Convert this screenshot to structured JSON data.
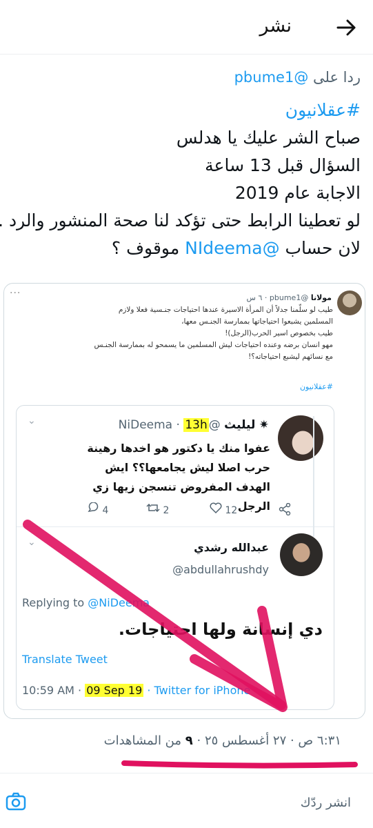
{
  "header": {
    "title": "نشر",
    "back_icon": "arrow-right-icon"
  },
  "reply_context": {
    "prefix": "ردا على",
    "handle": "@pbume1"
  },
  "tweet": {
    "hashtag": "#عقلانيون",
    "lines": [
      "صباح الشر عليك يا هدلس",
      "السؤال قبل 13 ساعة",
      "الاجابة عام 2019",
      "لو تعطينا الرابط حتى تؤكد لنا صحة المنشور والرد ."
    ],
    "last_line_prefix": "لان حساب",
    "last_line_mention": "@NIdeema",
    "last_line_suffix": "موقوف ؟"
  },
  "screenshot": {
    "author_name": "مولانا",
    "author_handle": "@pbume1",
    "author_time": "· ٦ س",
    "more_icon": "···",
    "body": [
      "طيب لو سلّمنا جدلاً أن المرأة الاسيرة عندها احتياجات جنـسية فعلا ولازم",
      "المسلمين يشبعوا احتياجاتها بممارسة الجنـس معها،",
      "طيب بخصوص اسير الحرب(الرجل)!",
      "مهو انسان برضه وعنده احتياجات ليش المسلمين ما يسمحو له بممارسة الجنـس",
      "مع نسائهم ليشبع احتياجاته؟!"
    ],
    "hashtag": "#عقلانيون",
    "embed": {
      "name1": "ليليث",
      "name1_symbol": "✷",
      "handle1": "@NiDeema",
      "time1": "13h",
      "text1": "عفوا منك يا دكتور هو اخدها رهينة حرب اصلا ليش يجامعها؟؟ ايش الهدف المفروض تنسجن زيها زي الرجل",
      "reply_count": "4",
      "retweet_count": "2",
      "like_count": "12",
      "name2": "عبدالله رشدي",
      "handle2": "@abdullahrushdy",
      "replying_prefix": "Replying to",
      "replying_handle": "@NiDeema",
      "text2": "دي إنسانة ولها احتياجات.",
      "translate": "Translate Tweet",
      "time2": "10:59 AM ·",
      "date2": "09 Sep 19",
      "source": "· Twitter for iPhone"
    }
  },
  "footer": {
    "timestamp": "٦:٣١ ص · ٢٧ أغسطس ٢٥ ·",
    "views_count": "٩",
    "views_label": "من المشاهدات",
    "reply_placeholder": "انشر ردّك",
    "camera_icon": "camera-icon"
  },
  "colors": {
    "accent": "#1d9bf0",
    "highlight": "#ffff33",
    "annotation": "#e0115f"
  }
}
